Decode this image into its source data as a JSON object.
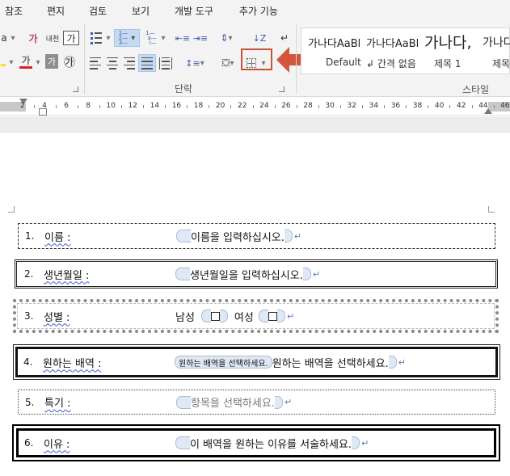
{
  "menu": [
    "참조",
    "편지",
    "검토",
    "보기",
    "개발 도구",
    "추가 기능"
  ],
  "ribbon": {
    "paragraph_group_label": "단락",
    "styles_group_label": "스타일",
    "font_buttons": {
      "clear_format": "가",
      "phonetic": "내천",
      "char_border": "가",
      "font_color": "가",
      "char_shading": "가",
      "enclosed": "㉮"
    },
    "styles": [
      {
        "preview": "가나다AaBl",
        "caption": "Default"
      },
      {
        "preview": "가나다AaBl",
        "caption": "↲ 간격 없음"
      },
      {
        "preview": "가나다,",
        "caption": "제목 1"
      },
      {
        "preview": "가나다",
        "caption": "제목"
      }
    ]
  },
  "ruler": {
    "marks": [
      "2",
      "4",
      "6",
      "8",
      "10",
      "12",
      "14",
      "16",
      "18",
      "20",
      "22",
      "24",
      "26",
      "28",
      "30",
      "32",
      "34",
      "36",
      "38",
      "40",
      "42",
      "44",
      "46"
    ]
  },
  "form": {
    "fields": [
      {
        "num": "1.",
        "label": "이름 :",
        "placeholder": "이름을 입력하십시오."
      },
      {
        "num": "2.",
        "label": "생년월일 :",
        "placeholder": "생년월일을 입력하십시오."
      },
      {
        "num": "3.",
        "label": "성별 :",
        "male": "남성",
        "female": "여성"
      },
      {
        "num": "4.",
        "label": "원하는 배역 :",
        "dropdown": "원하는 배역을 선택하세요.",
        "placeholder": "원하는 배역을 선택하세요."
      },
      {
        "num": "5.",
        "label": "특기 :",
        "placeholder": "항목을 선택하세요."
      },
      {
        "num": "6.",
        "label": "이유 :",
        "placeholder": "이 배역을 원하는 이유를 서술하세요."
      }
    ],
    "pilcrow": "↵"
  },
  "colors": {
    "accent_box": "#c9523b",
    "font_color_bar": "#e02020",
    "highlight_bar": "#f4e21c"
  }
}
